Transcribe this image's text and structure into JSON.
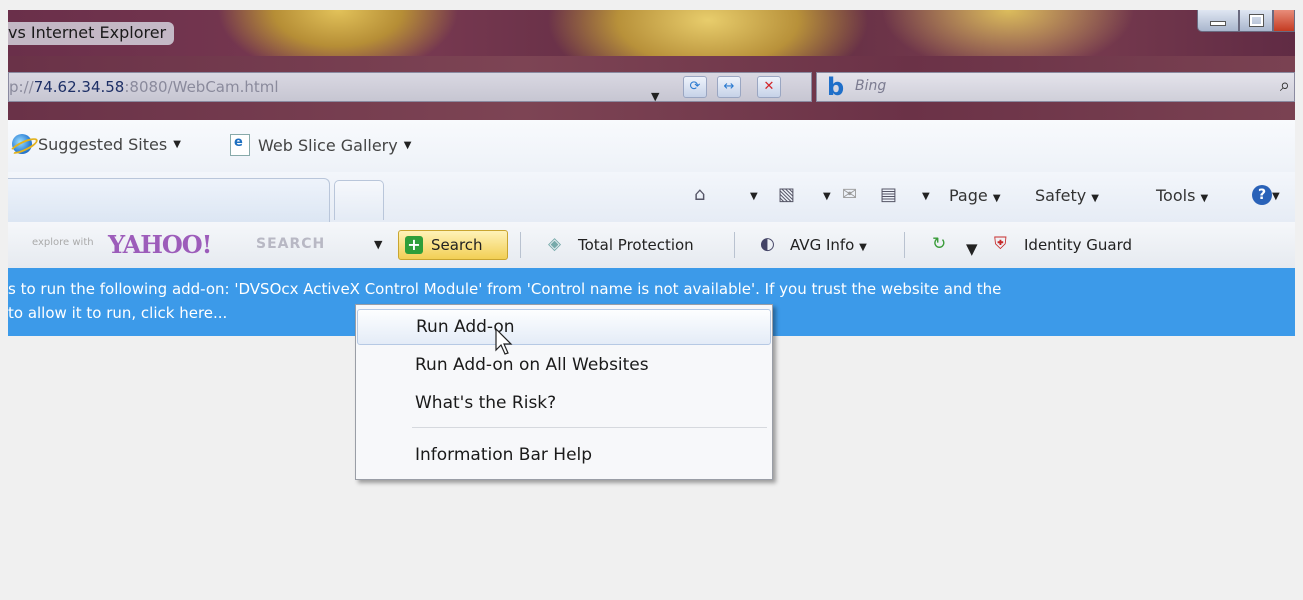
{
  "window": {
    "title": "vs Internet Explorer"
  },
  "address_bar": {
    "url_prefix": "p://",
    "url_host": "74.62.34.58",
    "url_rest": ":8080/WebCam.html",
    "dropdown": "▼",
    "refresh": "⟳",
    "compat": "↔",
    "stop": "✕"
  },
  "search": {
    "engine_glyph": "b",
    "placeholder": "Bing",
    "icon": "⌕"
  },
  "favorites": {
    "suggested_sites": "Suggested Sites",
    "web_slice_gallery": "Web Slice Gallery"
  },
  "command_bar": {
    "page": "Page",
    "safety": "Safety",
    "tools": "Tools",
    "help": "?"
  },
  "yahoo_toolbar": {
    "explore_text": "explore with",
    "logo": "YAHOO!",
    "search_word": "SEARCH",
    "search_button": "Search",
    "total_protection": "Total Protection",
    "avg_info": "AVG Info",
    "identity_guard": "Identity Guard"
  },
  "info_bar": {
    "line1": "s to run the following add-on: 'DVSOcx ActiveX Control Module' from 'Control name is not available'. If you trust the website and the",
    "line2": "to allow it to run, click here..."
  },
  "context_menu": {
    "items": [
      "Run Add-on",
      "Run Add-on on All Websites",
      "What's the Risk?",
      "Information Bar Help"
    ]
  },
  "colors": {
    "info_bar": "#3c9ae9",
    "menu_background": "#f7f8fa",
    "search_button": "#f2cf55"
  }
}
